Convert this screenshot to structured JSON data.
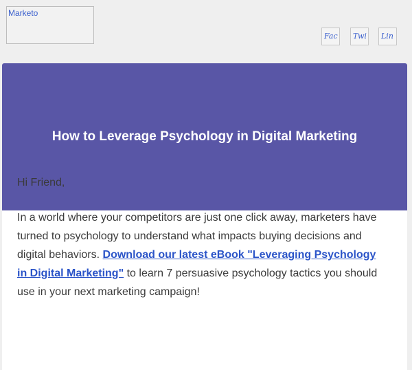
{
  "header": {
    "logo_alt": "Marketo",
    "social": {
      "facebook": "Fac",
      "twitter": "Twi",
      "linkedin": "Lin"
    }
  },
  "hero": {
    "title": "How to Leverage Psychology in Digital Marketing",
    "background": "#5956a6"
  },
  "body": {
    "greeting": "Hi Friend,",
    "paragraph_before": "In a world where your competitors are just one click away, marketers have turned to psychology to understand what impacts buying decisions and digital behaviors. ",
    "link_text": "Download our latest eBook \"Leveraging Psychology in Digital Marketing\"",
    "paragraph_after": " to learn 7 persuasive psychology tactics you should use in your next marketing campaign!"
  },
  "colors": {
    "page_bg": "#efefef",
    "link": "#2b54c8",
    "text": "#3a3a3a"
  },
  "icons": [
    "facebook-icon",
    "twitter-icon",
    "linkedin-icon"
  ]
}
